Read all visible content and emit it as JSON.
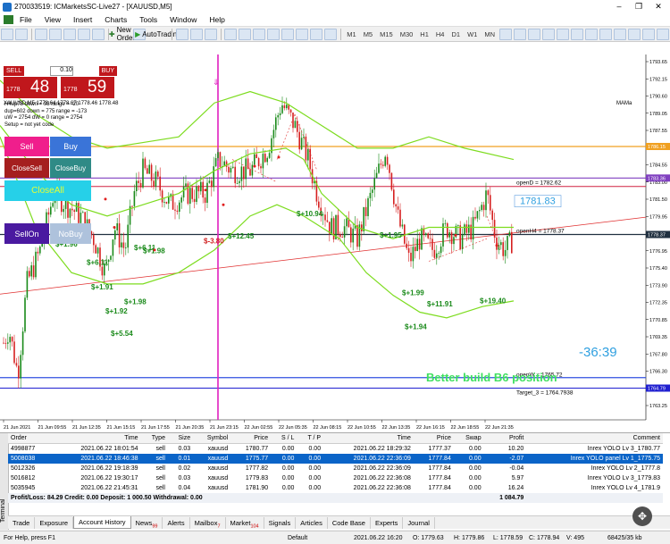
{
  "window": {
    "title": "270033519: ICMarketsSC-Live27 - [XAUUSD,M5]",
    "minimize": "–",
    "maximize": "❐",
    "close": "✕"
  },
  "menu": [
    "File",
    "View",
    "Insert",
    "Charts",
    "Tools",
    "Window",
    "Help"
  ],
  "toolbar": {
    "new_order": "New Order",
    "autotrading": "AutoTrading",
    "timeframes": [
      "M1",
      "M5",
      "M15",
      "M30",
      "H1",
      "H4",
      "D1",
      "W1",
      "MN"
    ]
  },
  "chart": {
    "symbol_label": "XAUUSD,M5  1778.64 1778.67 1778.46 1778.48",
    "indicator_label": "MAMa",
    "price_axis": [
      "1793.65",
      "1792.15",
      "1790.60",
      "1789.05",
      "1787.55",
      "1786.00",
      "1784.55",
      "1783.00",
      "1781.50",
      "1779.95",
      "1778.45",
      "1776.95",
      "1775.40",
      "1773.90",
      "1772.35",
      "1770.85",
      "1769.35",
      "1767.80",
      "1766.30",
      "1764.80",
      "1763.25"
    ],
    "time_axis": [
      "21 Jun 2021",
      "21 Jun 09:55",
      "21 Jun 12:35",
      "21 Jun 15:15",
      "21 Jun 17:55",
      "21 Jun 20:35",
      "21 Jun 23:15",
      "22 Jun 02:55",
      "22 Jun 05:35",
      "22 Jun 08:15",
      "22 Jun 10:55",
      "22 Jun 13:35",
      "22 Jun 16:15",
      "22 Jun 18:55",
      "22 Jun 21:35"
    ],
    "price_tags": {
      "orange": "1786.15",
      "purple": "1783.36",
      "current": "1778.37",
      "blue": "1764.79"
    },
    "labels": {
      "openD": "openD = 1782.62",
      "big_price": "1781.83",
      "openH4": "openH4 = 1778.37",
      "openW": "openW = 1765.72",
      "target": "Target_3 = 1764.7938",
      "timer": "-36:39",
      "banner": "Better build B6 position"
    },
    "profit_labels": [
      "$+1.96",
      "$+6.11",
      "$+6.11",
      "$+1.98",
      "$+1.91",
      "$+1.98",
      "$+1.92",
      "$+5.54",
      "$+12.45",
      "$-3.80",
      "$+10.94",
      "$+1.95",
      "$+1.99",
      "$+11.91",
      "$+19.40",
      "$+1.94"
    ]
  },
  "trade_panel": {
    "sell": "SELL",
    "buy": "BUY",
    "lot": "0.10",
    "sell_prefix": "1778",
    "sell_big": "48",
    "buy_prefix": "1778",
    "buy_big": "59"
  },
  "info_lines": [
    "H4up78 down = 98 range = -20",
    "dup=602  down = 775 range = -173",
    "uW = 2754  dW = 0 range = 2754",
    "Setup = not yet code"
  ],
  "panel_buttons": {
    "sell": "Sell",
    "buy": "Buy",
    "close_sell": "CloseSell",
    "close_buy": "CloseBuy",
    "close_all": "CloseAll",
    "sell_on": "SellOn",
    "no_buy": "NoBuy"
  },
  "terminal": {
    "side_label": "Terminal",
    "columns": [
      "Order",
      "/",
      "Time",
      "Type",
      "Size",
      "Symbol",
      "Price",
      "S / L",
      "T / P",
      "Time",
      "Price",
      "Swap",
      "Profit",
      "Comment"
    ],
    "rows": [
      [
        "4998877",
        "2021.06.22 18:01:54",
        "sell",
        "0.03",
        "xauusd",
        "1780.77",
        "0.00",
        "0.00",
        "2021.06.22 18:29:32",
        "1777.37",
        "0.00",
        "10.20",
        "Inrex YOLO Lv 3_1780.77"
      ],
      [
        "5008038",
        "2021.06.22 18:46:38",
        "sell",
        "0.01",
        "xauusd",
        "1775.77",
        "0.00",
        "0.00",
        "2021.06.22 22:36:09",
        "1777.84",
        "0.00",
        "-2.07",
        "Inrex YOLO panel Lv 1_1775.75"
      ],
      [
        "5012326",
        "2021.06.22 19:18:39",
        "sell",
        "0.02",
        "xauusd",
        "1777.82",
        "0.00",
        "0.00",
        "2021.06.22 22:36:09",
        "1777.84",
        "0.00",
        "-0.04",
        "Inrex YOLO Lv 2_1777.8"
      ],
      [
        "5016812",
        "2021.06.22 19:30:17",
        "sell",
        "0.03",
        "xauusd",
        "1779.83",
        "0.00",
        "0.00",
        "2021.06.22 22:36:08",
        "1777.84",
        "0.00",
        "5.97",
        "Inrex YOLO Lv 3_1779.83"
      ],
      [
        "5035945",
        "2021.06.22 21:45:31",
        "sell",
        "0.04",
        "xauusd",
        "1781.90",
        "0.00",
        "0.00",
        "2021.06.22 22:36:08",
        "1777.84",
        "0.00",
        "16.24",
        "Inrex YOLO Lv 4_1781.9"
      ]
    ],
    "summary": "Profit/Loss: 84.29  Credit: 0.00  Deposit: 1 000.50  Withdrawal: 0.00",
    "summary_total": "1 084.79",
    "tabs": [
      {
        "label": "Trade"
      },
      {
        "label": "Exposure"
      },
      {
        "label": "Account History",
        "active": true
      },
      {
        "label": "News",
        "badge": "99"
      },
      {
        "label": "Alerts"
      },
      {
        "label": "Mailbox",
        "badge": "7"
      },
      {
        "label": "Market",
        "badge": "104"
      },
      {
        "label": "Signals"
      },
      {
        "label": "Articles"
      },
      {
        "label": "Code Base"
      },
      {
        "label": "Experts"
      },
      {
        "label": "Journal"
      }
    ]
  },
  "status": {
    "help": "For Help, press F1",
    "profile": "Default",
    "datetime": "2021.06.22 16:20",
    "open": "O: 1779.63",
    "high": "H: 1779.86",
    "low": "L: 1778.59",
    "close": "C: 1778.94",
    "volume": "V: 495",
    "traffic": "68425/35 kb"
  },
  "colors": {
    "bull": "#1a8a1a",
    "bear": "#d62020",
    "ma": "#7ddc1f",
    "crosshair": "#e020c0",
    "orange_line": "#f0a020",
    "purple_line": "#8040c0",
    "blue_line": "#2020d0",
    "accent_red": "#c0171c"
  }
}
